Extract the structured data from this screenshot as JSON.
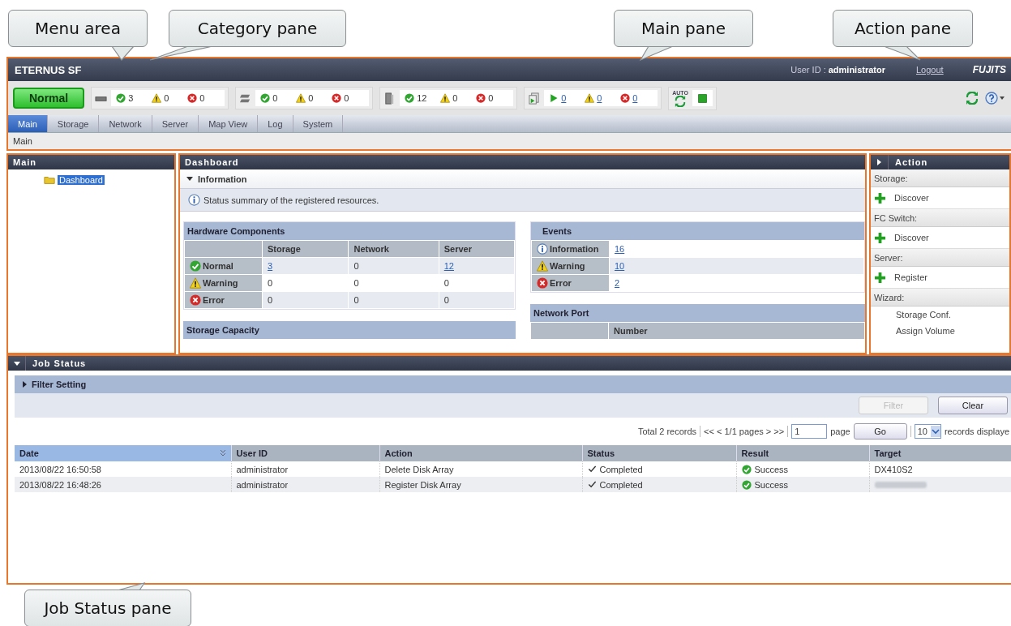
{
  "callouts": [
    {
      "label": "Menu area"
    },
    {
      "label": "Category pane"
    },
    {
      "label": "Main pane"
    },
    {
      "label": "Action pane"
    },
    {
      "label": "Job Status pane"
    }
  ],
  "header": {
    "product": "ETERNUS SF",
    "user_label": "User ID :",
    "user": "administrator",
    "logout": "Logout",
    "brand": "FUJITS"
  },
  "status": {
    "overall": "Normal",
    "auto_label": "AUTO",
    "groups": [
      {
        "kind": "storage",
        "counts": [
          {
            "kind": "normal",
            "value": "3",
            "link": false
          },
          {
            "kind": "warning",
            "value": "0",
            "link": false
          },
          {
            "kind": "error",
            "value": "0",
            "link": false
          }
        ]
      },
      {
        "kind": "network",
        "counts": [
          {
            "kind": "normal",
            "value": "0",
            "link": false
          },
          {
            "kind": "warning",
            "value": "0",
            "link": false
          },
          {
            "kind": "error",
            "value": "0",
            "link": false
          }
        ]
      },
      {
        "kind": "server",
        "counts": [
          {
            "kind": "normal",
            "value": "12",
            "link": false
          },
          {
            "kind": "warning",
            "value": "0",
            "link": false
          },
          {
            "kind": "error",
            "value": "0",
            "link": false
          }
        ]
      },
      {
        "kind": "jobs",
        "counts": [
          {
            "kind": "running",
            "value": "0",
            "link": true
          },
          {
            "kind": "warning",
            "value": "0",
            "link": true
          },
          {
            "kind": "error",
            "value": "0",
            "link": true
          }
        ]
      }
    ]
  },
  "tabs": [
    {
      "label": "Main",
      "selected": true
    },
    {
      "label": "Storage",
      "selected": false
    },
    {
      "label": "Network",
      "selected": false
    },
    {
      "label": "Server",
      "selected": false
    },
    {
      "label": "Map View",
      "selected": false
    },
    {
      "label": "Log",
      "selected": false
    },
    {
      "label": "System",
      "selected": false
    }
  ],
  "breadcrumb": "Main",
  "category": {
    "title": "Main",
    "items": [
      {
        "label": "Dashboard",
        "selected": true
      }
    ]
  },
  "main": {
    "title": "Dashboard",
    "info": {
      "title": "Information",
      "expanded": true,
      "message": "Status summary of the registered resources."
    },
    "hardware": {
      "title": "Hardware Components",
      "columns": [
        "Storage",
        "Network",
        "Server"
      ],
      "rows": [
        {
          "kind": "normal",
          "label": "Normal",
          "cells": [
            {
              "text": "3",
              "link": true
            },
            {
              "text": "0",
              "link": false
            },
            {
              "text": "12",
              "link": true
            }
          ]
        },
        {
          "kind": "warning",
          "label": "Warning",
          "cells": [
            {
              "text": "0",
              "link": false
            },
            {
              "text": "0",
              "link": false
            },
            {
              "text": "0",
              "link": false
            }
          ]
        },
        {
          "kind": "error",
          "label": "Error",
          "cells": [
            {
              "text": "0",
              "link": false
            },
            {
              "text": "0",
              "link": false
            },
            {
              "text": "0",
              "link": false
            }
          ]
        }
      ]
    },
    "storage_capacity": {
      "title": "Storage Capacity"
    },
    "events": {
      "title": "Events",
      "rows": [
        {
          "kind": "info",
          "label": "Information",
          "value": "16"
        },
        {
          "kind": "warning",
          "label": "Warning",
          "value": "10"
        },
        {
          "kind": "error",
          "label": "Error",
          "value": "2"
        }
      ]
    },
    "network_port": {
      "title": "Network Port",
      "columns": [
        "Number"
      ]
    }
  },
  "action": {
    "title": "Action",
    "expanded": false,
    "sections": [
      {
        "label": "Storage:",
        "items": [
          {
            "kind": "add",
            "label": "Discover"
          }
        ]
      },
      {
        "label": "FC Switch:",
        "items": [
          {
            "kind": "add",
            "label": "Discover"
          }
        ]
      },
      {
        "label": "Server:",
        "items": [
          {
            "kind": "add",
            "label": "Register"
          }
        ]
      },
      {
        "label": "Wizard:",
        "items": [
          {
            "kind": "plain",
            "label": "Storage Conf."
          },
          {
            "kind": "plain",
            "label": "Assign Volume"
          }
        ]
      }
    ]
  },
  "jobs": {
    "title": "Job Status",
    "expanded": true,
    "filter": {
      "title": "Filter Setting",
      "expanded": false,
      "buttons": [
        {
          "label": "Filter",
          "disabled": true
        },
        {
          "label": "Clear",
          "disabled": false
        }
      ]
    },
    "pager": {
      "total": "Total 2 records",
      "nav": "<< < 1/1 pages > >>",
      "page": "1",
      "page_label": "page",
      "go": "Go",
      "per_page": "10",
      "per_page_label": "records displaye"
    },
    "columns": [
      {
        "label": "Date",
        "sorted": true
      },
      {
        "label": "User ID",
        "sorted": false
      },
      {
        "label": "Action",
        "sorted": false
      },
      {
        "label": "Status",
        "sorted": false
      },
      {
        "label": "Result",
        "sorted": false
      },
      {
        "label": "Target",
        "sorted": false
      }
    ],
    "rows": [
      {
        "cells": [
          {
            "kind": "text",
            "text": "2013/08/22 16:50:58"
          },
          {
            "kind": "text",
            "text": "administrator"
          },
          {
            "kind": "text",
            "text": "Delete Disk Array"
          },
          {
            "kind": "completed",
            "text": "Completed"
          },
          {
            "kind": "success",
            "text": "Success"
          },
          {
            "kind": "text",
            "text": "DX410S2"
          }
        ]
      },
      {
        "cells": [
          {
            "kind": "text",
            "text": "2013/08/22 16:48:26"
          },
          {
            "kind": "text",
            "text": "administrator"
          },
          {
            "kind": "text",
            "text": "Register Disk Array"
          },
          {
            "kind": "completed",
            "text": "Completed"
          },
          {
            "kind": "success",
            "text": "Success"
          },
          {
            "kind": "blurred"
          }
        ]
      }
    ]
  }
}
